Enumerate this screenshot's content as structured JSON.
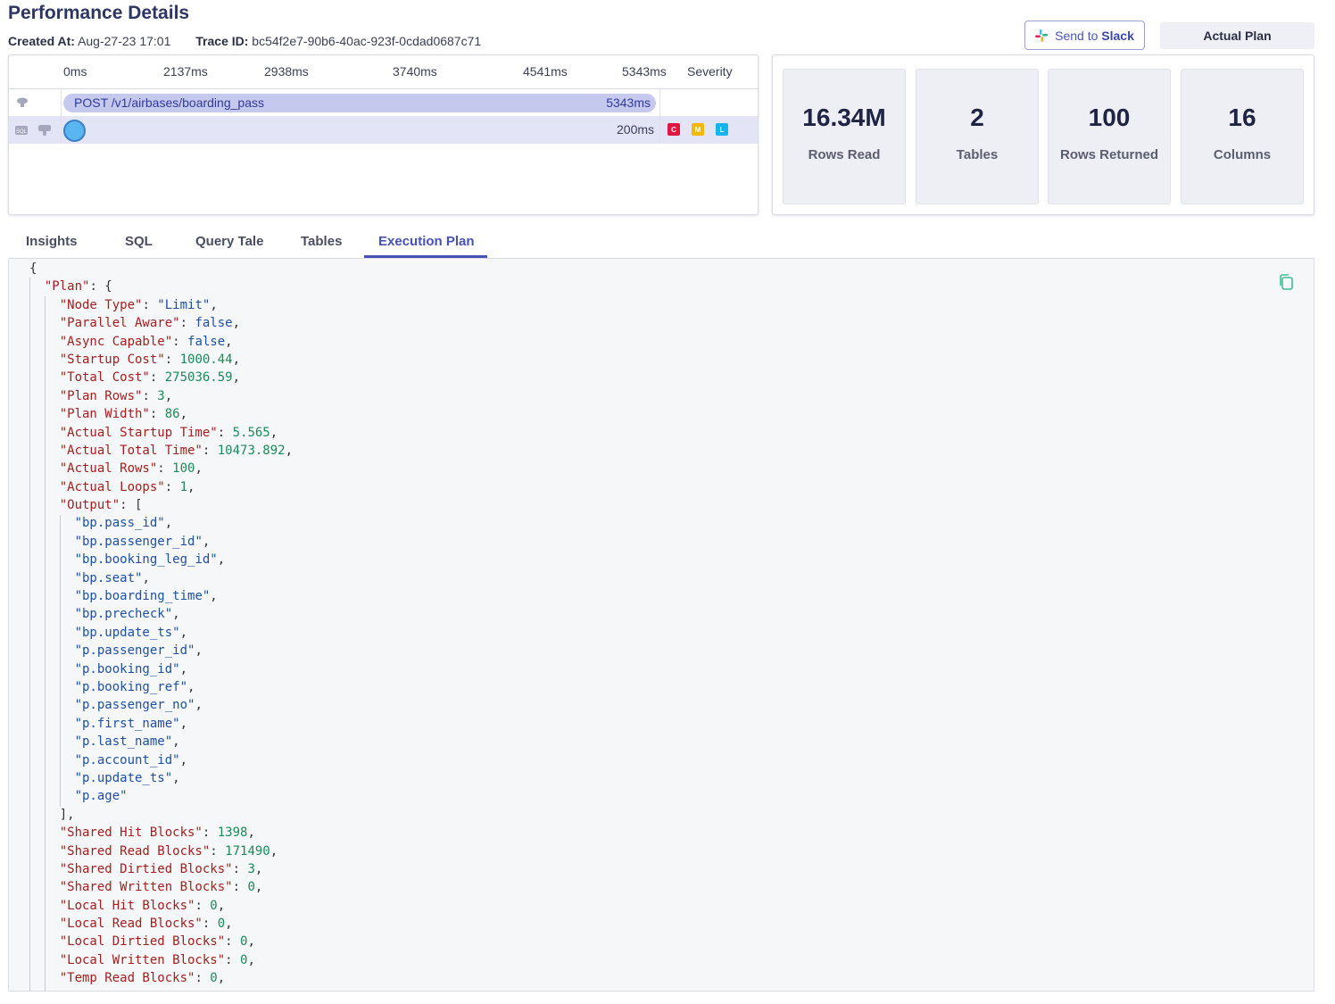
{
  "header": {
    "title": "Performance Details",
    "created_label": "Created At:",
    "created_value": "Aug-27-23 17:01",
    "trace_label": "Trace ID:",
    "trace_value": "bc54f2e7-90b6-40ac-923f-0cdad0687c71"
  },
  "actions": {
    "slack_prefix": "Send to",
    "slack_bold": "Slack",
    "actual_plan": "Actual Plan"
  },
  "timeline": {
    "ticks": [
      "0ms",
      "2137ms",
      "2938ms",
      "3740ms",
      "4541ms",
      "5343ms"
    ],
    "severity_header": "Severity",
    "request": {
      "label": "POST /v1/airbases/boarding_pass",
      "duration": "5343ms"
    },
    "query": {
      "duration": "200ms",
      "severity": [
        "C",
        "M",
        "L"
      ]
    }
  },
  "stats": [
    {
      "value": "16.34M",
      "label": "Rows Read"
    },
    {
      "value": "2",
      "label": "Tables"
    },
    {
      "value": "100",
      "label": "Rows Returned"
    },
    {
      "value": "16",
      "label": "Columns"
    }
  ],
  "tabs": [
    "Insights",
    "SQL",
    "Query Tale",
    "Tables",
    "Execution Plan"
  ],
  "active_tab": "Execution Plan",
  "plan": {
    "open": "{",
    "plan_key": "\"Plan\"",
    "plan_open": ": {",
    "fields_top": [
      {
        "k": "\"Node Type\"",
        "v": "\"Limit\"",
        "t": "str"
      },
      {
        "k": "\"Parallel Aware\"",
        "v": "false",
        "t": "bool"
      },
      {
        "k": "\"Async Capable\"",
        "v": "false",
        "t": "bool"
      },
      {
        "k": "\"Startup Cost\"",
        "v": "1000.44",
        "t": "num"
      },
      {
        "k": "\"Total Cost\"",
        "v": "275036.59",
        "t": "num"
      },
      {
        "k": "\"Plan Rows\"",
        "v": "3",
        "t": "num"
      },
      {
        "k": "\"Plan Width\"",
        "v": "86",
        "t": "num"
      },
      {
        "k": "\"Actual Startup Time\"",
        "v": "5.565",
        "t": "num"
      },
      {
        "k": "\"Actual Total Time\"",
        "v": "10473.892",
        "t": "num"
      },
      {
        "k": "\"Actual Rows\"",
        "v": "100",
        "t": "num"
      },
      {
        "k": "\"Actual Loops\"",
        "v": "1",
        "t": "num"
      }
    ],
    "output_key": "\"Output\"",
    "output_open": ": [",
    "output": [
      "\"bp.pass_id\"",
      "\"bp.passenger_id\"",
      "\"bp.booking_leg_id\"",
      "\"bp.seat\"",
      "\"bp.boarding_time\"",
      "\"bp.precheck\"",
      "\"bp.update_ts\"",
      "\"p.passenger_id\"",
      "\"p.booking_id\"",
      "\"p.booking_ref\"",
      "\"p.passenger_no\"",
      "\"p.first_name\"",
      "\"p.last_name\"",
      "\"p.account_id\"",
      "\"p.update_ts\"",
      "\"p.age\""
    ],
    "output_close": "],",
    "fields_bottom": [
      {
        "k": "\"Shared Hit Blocks\"",
        "v": "1398",
        "t": "num"
      },
      {
        "k": "\"Shared Read Blocks\"",
        "v": "171490",
        "t": "num"
      },
      {
        "k": "\"Shared Dirtied Blocks\"",
        "v": "3",
        "t": "num"
      },
      {
        "k": "\"Shared Written Blocks\"",
        "v": "0",
        "t": "num"
      },
      {
        "k": "\"Local Hit Blocks\"",
        "v": "0",
        "t": "num"
      },
      {
        "k": "\"Local Read Blocks\"",
        "v": "0",
        "t": "num"
      },
      {
        "k": "\"Local Dirtied Blocks\"",
        "v": "0",
        "t": "num"
      },
      {
        "k": "\"Local Written Blocks\"",
        "v": "0",
        "t": "num"
      },
      {
        "k": "\"Temp Read Blocks\"",
        "v": "0",
        "t": "num"
      }
    ]
  }
}
